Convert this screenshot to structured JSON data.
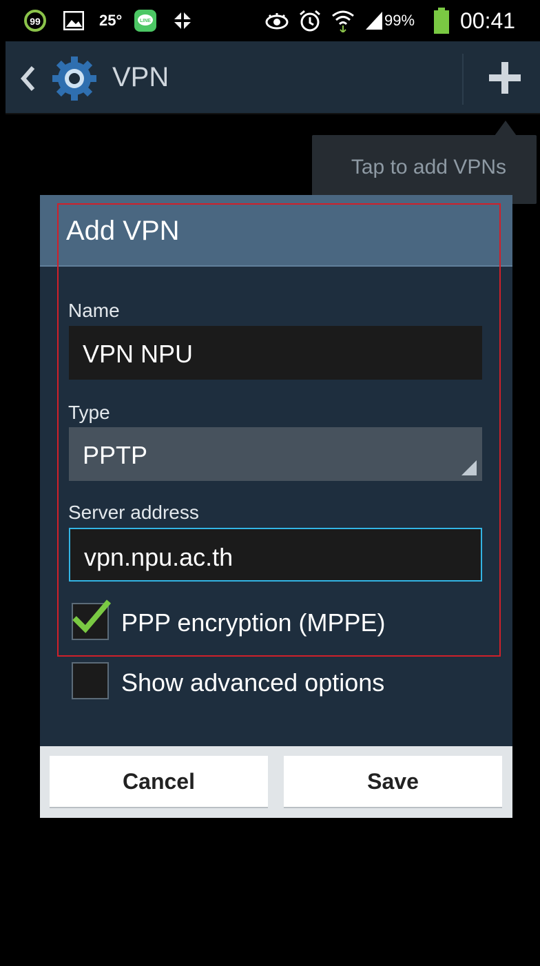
{
  "status_bar": {
    "notification_count": "99",
    "temperature": "25°",
    "line_app_label": "LINE",
    "battery_percent": "99%",
    "time": "00:41",
    "icons": [
      "circle-99-icon",
      "gallery-icon",
      "weather-icon",
      "line-icon",
      "pinwheel-icon",
      "eye-icon",
      "alarm-icon",
      "wifi-icon",
      "signal-icon",
      "battery-icon"
    ]
  },
  "action_bar": {
    "title": "VPN",
    "icons": [
      "back-chevron-icon",
      "settings-gear-icon",
      "add-icon"
    ]
  },
  "tooltip": {
    "text": "Tap to add VPNs"
  },
  "dialog": {
    "title": "Add VPN",
    "name_label": "Name",
    "name_value": "VPN NPU",
    "type_label": "Type",
    "type_value": "PPTP",
    "server_label": "Server address",
    "server_value": "vpn.npu.ac.th",
    "ppp_encryption_label": "PPP encryption (MPPE)",
    "ppp_encryption_checked": true,
    "advanced_label": "Show advanced options",
    "advanced_checked": false,
    "cancel_label": "Cancel",
    "save_label": "Save"
  },
  "colors": {
    "action_bar": "#1e2d3b",
    "dialog_header": "#4a6781",
    "dialog_body": "#1e2e3e",
    "accent": "#33b5e5",
    "check": "#7ac943",
    "highlight": "#d0202a"
  }
}
